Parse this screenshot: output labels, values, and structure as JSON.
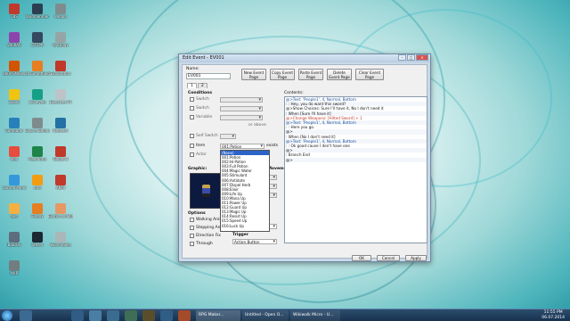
{
  "window": {
    "title": "Edit Event - EV001"
  },
  "name_section": {
    "label": "Name:",
    "value": "EV001"
  },
  "page_buttons": [
    {
      "label": "New Event Page"
    },
    {
      "label": "Copy Event Page"
    },
    {
      "label": "Paste Event Page"
    },
    {
      "label": "Delete Event Page"
    },
    {
      "label": "Clear Event Page"
    }
  ],
  "tabs": [
    "1",
    "2"
  ],
  "conditions": {
    "title": "Conditions",
    "rows": [
      {
        "label": "Switch"
      },
      {
        "label": "Switch"
      },
      {
        "label": "Variable"
      },
      {
        "label": "Self Switch"
      },
      {
        "label": "Item"
      },
      {
        "label": "Actor"
      }
    ],
    "item_value": "001:Potion",
    "item_suffix": "exists",
    "variable_suffix": "or above"
  },
  "item_dropdown": {
    "options": [
      "(None)",
      "001:Potion",
      "002:Hi-Potion",
      "003:Full Potion",
      "004:Magic Water",
      "005:Stimulant",
      "006:Antidote",
      "007:Dispel Herb",
      "008:Elixir",
      "009:Life Up",
      "010:Mana Up",
      "011:Power Up",
      "012:Guard Up",
      "013:Magic Up",
      "014:Resist Up",
      "015:Speed Up",
      "016:Luck Up"
    ],
    "selected": "(None)"
  },
  "graphic": {
    "title": "Graphic:"
  },
  "autonomous": {
    "title": "Autonomous Movement",
    "type_label": "Type:",
    "speed_label": "Speed:",
    "freq_label": "Freq:"
  },
  "options": {
    "title": "Options",
    "items": [
      "Walking Anim.",
      "Stepping Anim.",
      "Direction Fix",
      "Through"
    ]
  },
  "priority": {
    "title": "Priority",
    "value": "Below Characters"
  },
  "trigger": {
    "title": "Trigger",
    "value": "Action Button"
  },
  "contents": {
    "title": "Contents:",
    "lines": [
      "@>Text: 'People1', 4, Normal, Bottom",
      "  :      : Hey, you do want this sword?",
      "@>Show Choices: Sure I'll have it, No I don't need it",
      "  : When [Sure I'll have it]",
      "    @>Change Weapons: [Hilted Sword] + 1",
      "    @>Text: 'People1', 4, Normal, Bottom",
      "    :      : Here you go.",
      "    @>",
      "  : When [No I don't need it]",
      "    @>Text: 'People1', 4, Normal, Bottom",
      "    :      : Ok good cause I don't have one",
      "    @>",
      "  : Branch End",
      "@>",
      "",
      "",
      "",
      "",
      "",
      "",
      "",
      "",
      "",
      "",
      "",
      "",
      "",
      "",
      "",
      ""
    ]
  },
  "dialog_buttons": {
    "ok": "OK",
    "cancel": "Cancel",
    "apply": "Apply"
  },
  "desktop_icons": [
    {
      "label": "TBS",
      "color": "#c0392b"
    },
    {
      "label": "Workbenmer",
      "color": "#2c3e50"
    },
    {
      "label": "Weapp",
      "color": "#7f8c8d"
    },
    {
      "label": "WinRAR",
      "color": "#8e44ad"
    },
    {
      "label": "OTCPR",
      "color": "#34495e"
    },
    {
      "label": "MyDiggy",
      "color": "#95a5a6"
    },
    {
      "label": "ebRPGMaker",
      "color": "#d35400"
    },
    {
      "label": "ab Something",
      "color": "#e67e22"
    },
    {
      "label": "Exploration",
      "color": "#c0392b"
    },
    {
      "label": "Bookf",
      "color": "#f1c40f"
    },
    {
      "label": "ulk levels",
      "color": "#16a085"
    },
    {
      "label": "Exercises Fil",
      "color": "#bdc3c7"
    },
    {
      "label": "Computer",
      "color": "#2980b9"
    },
    {
      "label": "Source Balancing",
      "color": "#7f8c8d"
    },
    {
      "label": "Network",
      "color": "#2471a3"
    },
    {
      "label": "Mac",
      "color": "#e74c3c"
    },
    {
      "label": "Free Prom",
      "color": "#1e8449"
    },
    {
      "label": "Global 3",
      "color": "#c0392b"
    },
    {
      "label": "Control Panel",
      "color": "#3498db"
    },
    {
      "label": "mnt",
      "color": "#f39c12"
    },
    {
      "label": "ABMI",
      "color": "#c0392b"
    },
    {
      "label": "test",
      "color": "#f5b041"
    },
    {
      "label": "Firefox",
      "color": "#e67e22"
    },
    {
      "label": "Exotics to Mother",
      "color": "#e59866"
    },
    {
      "label": "BISBUS",
      "color": "#5d6d7e"
    },
    {
      "label": "Steam",
      "color": "#1c2833"
    },
    {
      "label": "Word Joules",
      "color": "#aab7b8"
    },
    {
      "label": "NAP",
      "color": "#717d7e"
    }
  ],
  "taskbar": {
    "items": [
      "RPG Maker...",
      "Untitled - Open O...",
      "Wikiwalk Micro - U..."
    ],
    "time": "11:55 PM",
    "date": "06.07.2014",
    "colors": {
      "bar": "#16324f",
      "accent": "#2b63c9"
    }
  }
}
